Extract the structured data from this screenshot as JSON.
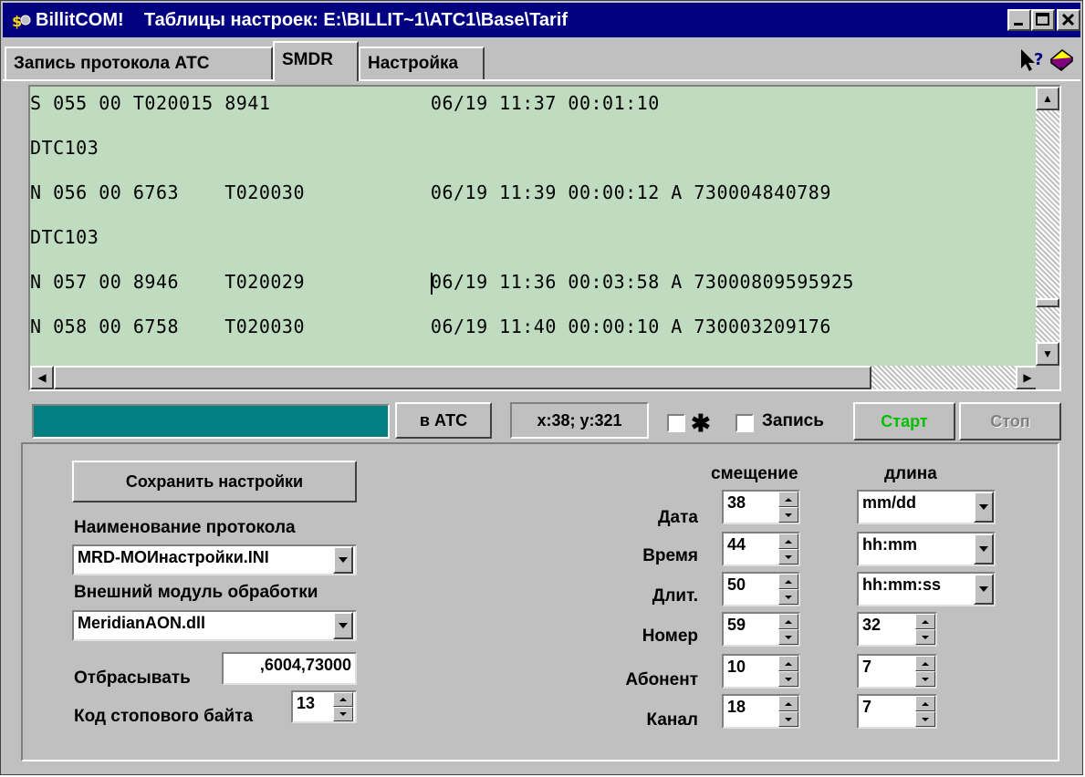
{
  "window": {
    "title": "BillitCOM!    Таблицы настроек: E:\\BILLIT~1\\ATC1\\Base\\Tarif"
  },
  "tabs": [
    {
      "label": "Запись протокола АТС",
      "active": false
    },
    {
      "label": "SMDR",
      "active": true
    },
    {
      "label": "Настройка",
      "active": false
    }
  ],
  "log": {
    "lines": [
      "S 055 00 T020015 8941              06/19 11:37 00:01:10",
      "DTC103",
      "N 056 00 6763    T020030           06/19 11:39 00:00:12 A 730004840789",
      "DTC103",
      "N 057 00 8946    T020029           ",
      "N 058 00 6758    T020030           06/19 11:40 00:00:10 A 730003209176"
    ],
    "caret_line_tail": "06/19 11:36 00:03:58 A 73000809595925"
  },
  "toolbar": {
    "send_button": "в АТС",
    "coords": "x:38; y:321",
    "asterisk": "✱",
    "record_label": "Запись",
    "start_button": "Старт",
    "stop_button": "Стоп"
  },
  "settings": {
    "save_button": "Сохранить настройки",
    "protocol_label": "Наименование протокола",
    "protocol_value": "MRD-МОИнастройки.INI",
    "module_label": "Внешний модуль обработки",
    "module_value": "MeridianAON.dll",
    "discard_label": "Отбрасывать",
    "discard_value": ",6004,73000",
    "stopbyte_label": "Код стопового байта",
    "stopbyte_value": "13",
    "offset_header": "смещение",
    "length_header": "длина",
    "rows": [
      {
        "label": "Дата",
        "offset": "38",
        "length": "mm/dd"
      },
      {
        "label": "Время",
        "offset": "44",
        "length": "hh:mm"
      },
      {
        "label": "Длит.",
        "offset": "50",
        "length": "hh:mm:ss"
      },
      {
        "label": "Номер",
        "offset": "59",
        "length": "32"
      },
      {
        "label": "Абонент",
        "offset": "10",
        "length": "7"
      },
      {
        "label": "Канал",
        "offset": "18",
        "length": "7"
      }
    ]
  },
  "colors": {
    "title_bar": "#000080",
    "log_bg": "#c0dcc0",
    "progress": "#008080",
    "start_text": "#00c000",
    "stop_text": "#808080"
  }
}
